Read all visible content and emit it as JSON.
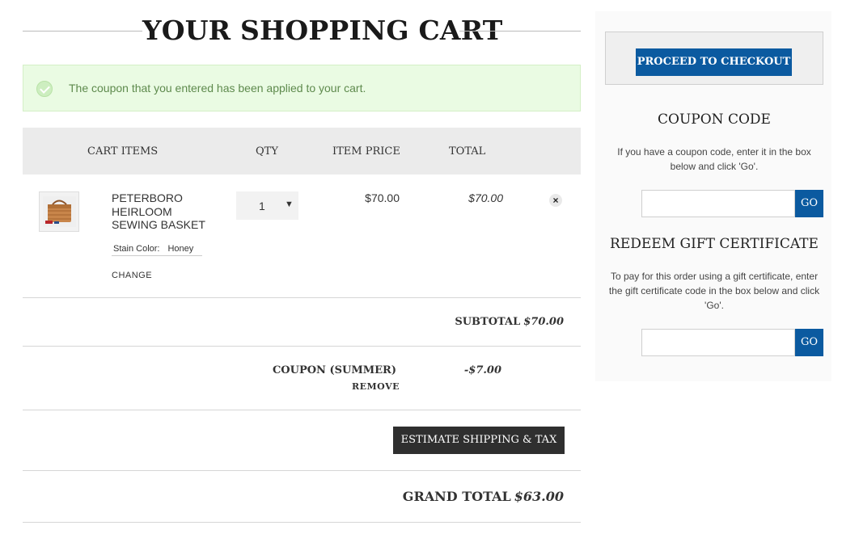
{
  "header": {
    "title": "YOUR SHOPPING CART"
  },
  "alert": {
    "message": "The coupon that you entered has been applied to your cart.",
    "icon": "check-circle-icon"
  },
  "cart_table": {
    "columns": [
      "CART ITEMS",
      "QTY",
      "ITEM PRICE",
      "TOTAL"
    ],
    "items": [
      {
        "name": "PETERBORO HEIRLOOM SEWING BASKET",
        "option_label": "Stain Color:",
        "option_value": "Honey",
        "change_label": "CHANGE",
        "qty": "1",
        "price": "$70.00",
        "total": "$70.00",
        "remove_icon": "×"
      }
    ]
  },
  "totals": {
    "subtotal_label": "SUBTOTAL",
    "subtotal_value": "$70.00",
    "coupon_label": "COUPON (SUMMER)",
    "coupon_remove": "REMOVE",
    "coupon_value": "-$7.00",
    "estimate_button": "ESTIMATE SHIPPING & TAX",
    "grand_total_label": "GRAND TOTAL",
    "grand_total_value": "$63.00"
  },
  "sidebar": {
    "checkout_button": "PROCEED TO CHECKOUT",
    "coupon": {
      "title": "COUPON CODE",
      "description": "If you have a coupon code, enter it in the box below and click 'Go'.",
      "input_value": "",
      "go_label": "GO"
    },
    "gift": {
      "title": "REDEEM GIFT CERTIFICATE",
      "description": "To pay for this order using a gift certificate, enter the gift certificate code in the box below and click 'Go'.",
      "input_value": "",
      "go_label": "GO"
    }
  },
  "colors": {
    "primary_button": "#0b5aa0",
    "dark_button": "#2f2f2f",
    "alert_bg": "#eafbe3",
    "alert_text": "#5e8a4d",
    "table_header_bg": "#ebebeb"
  }
}
